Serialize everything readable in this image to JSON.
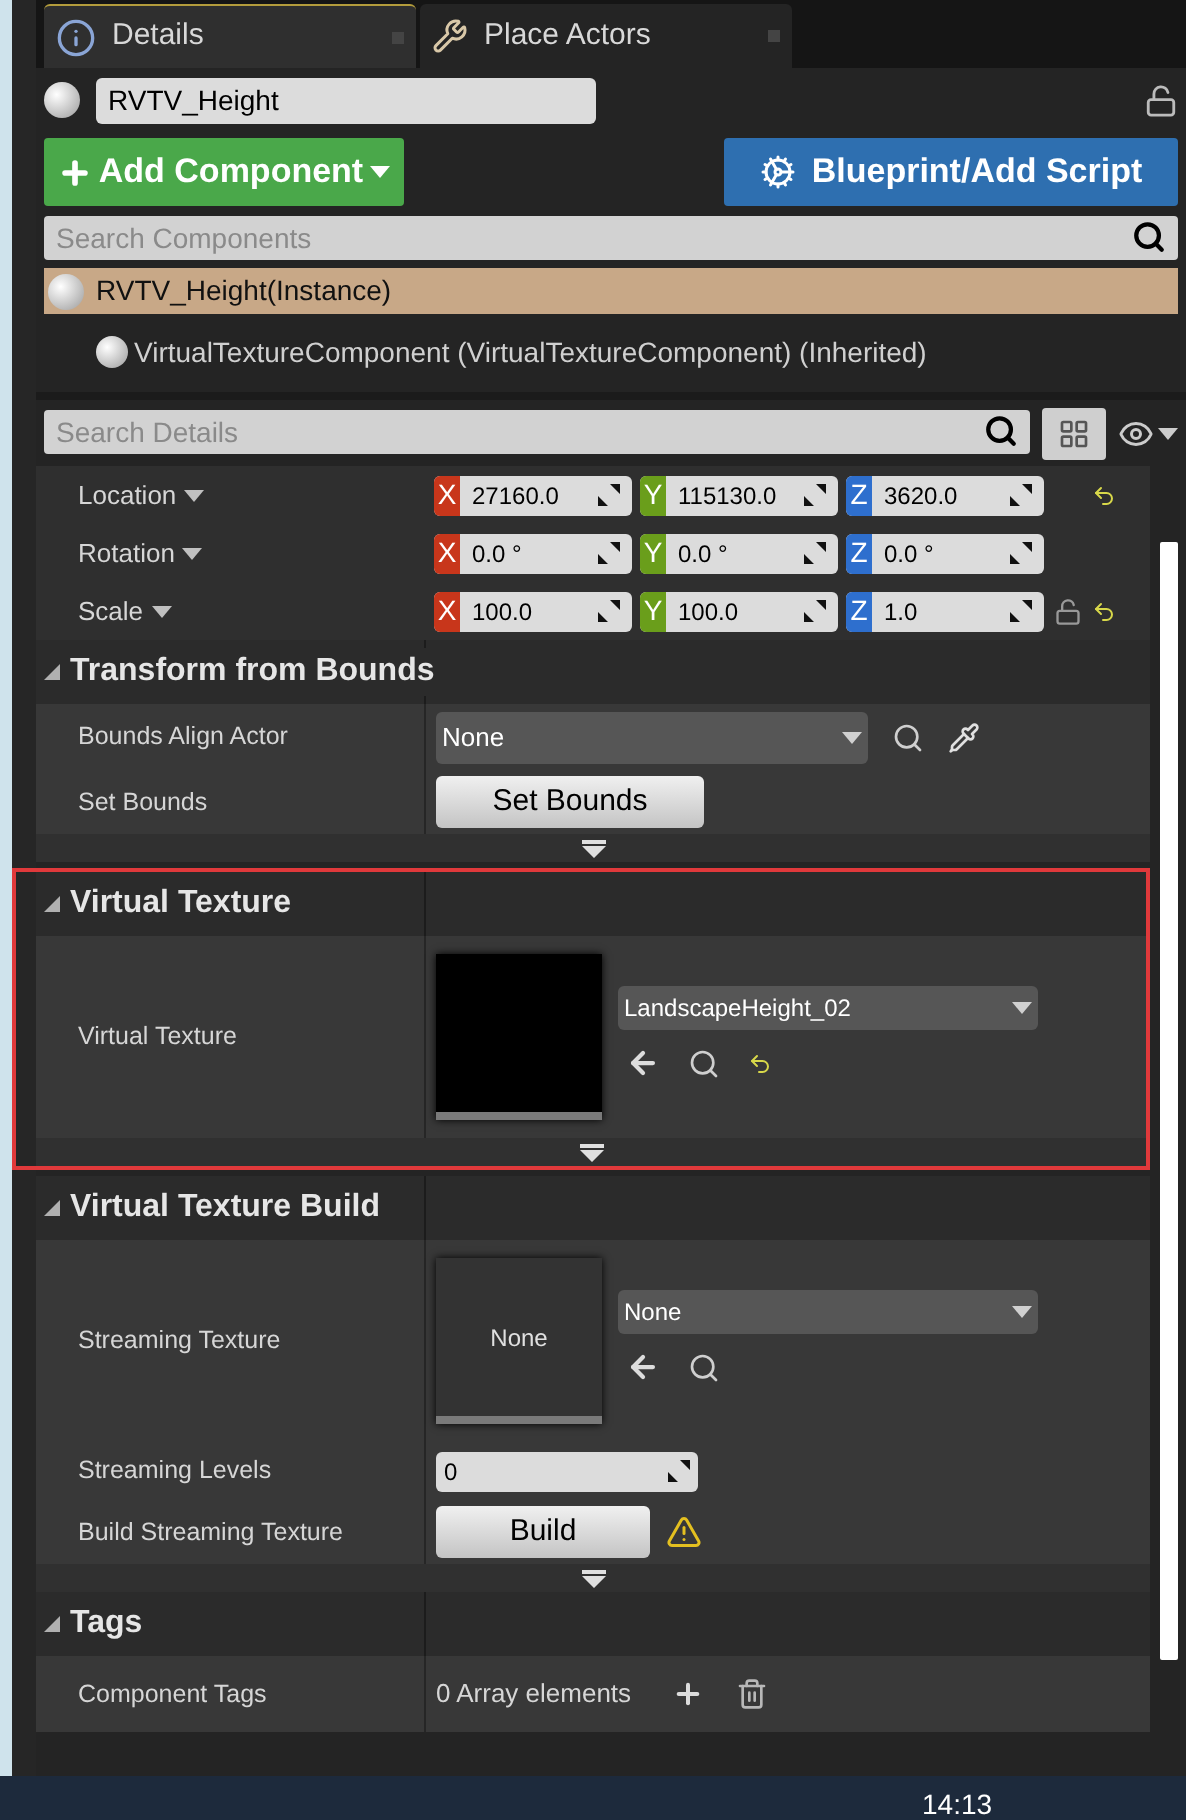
{
  "tabs": [
    {
      "label": "Details",
      "selected": true
    },
    {
      "label": "Place Actors",
      "selected": false
    }
  ],
  "actor": {
    "name": "RVTV_Height",
    "locked": false
  },
  "add_component": {
    "label": "Add Component"
  },
  "blueprint": {
    "label": "Blueprint/Add Script"
  },
  "component_search": {
    "placeholder": "Search Components"
  },
  "components": [
    {
      "label": "RVTV_Height(Instance)",
      "selected": true,
      "children": [
        {
          "label": "VirtualTextureComponent (VirtualTextureComponent) (Inherited)",
          "selected": false
        }
      ]
    }
  ],
  "details_search": {
    "placeholder": "Search Details"
  },
  "transform": [
    {
      "label": "Location",
      "axes": [
        "X",
        "Y",
        "Z"
      ],
      "values": [
        "27160.0",
        "115130.0",
        "3620.0"
      ],
      "lockable": false,
      "reset": true
    },
    {
      "label": "Rotation",
      "axes": [
        "X",
        "Y",
        "Z"
      ],
      "values": [
        "0.0 °",
        "0.0 °",
        "0.0 °"
      ],
      "lockable": false,
      "reset": false
    },
    {
      "label": "Scale",
      "axes": [
        "X",
        "Y",
        "Z"
      ],
      "values": [
        "100.0",
        "100.0",
        "1.0"
      ],
      "lockable": true,
      "reset": true
    }
  ],
  "sections": [
    {
      "title": "Transform from Bounds",
      "highlighted": false,
      "more": true,
      "rows": [
        {
          "kind": "combo",
          "label": "Bounds Align Actor",
          "value": "None"
        },
        {
          "kind": "button",
          "label": "Set Bounds",
          "button": "Set Bounds",
          "warning": false
        }
      ]
    },
    {
      "title": "Virtual Texture",
      "highlighted": true,
      "more": true,
      "rows": [
        {
          "kind": "asset",
          "label": "Virtual Texture",
          "value": "LandscapeHeight_02",
          "assigned": true,
          "reset": true
        }
      ]
    },
    {
      "title": "Virtual Texture Build",
      "highlighted": false,
      "more": true,
      "rows": [
        {
          "kind": "asset",
          "label": "Streaming Texture",
          "value": "None",
          "assigned": false,
          "thumbnail_label": "None",
          "reset": false
        },
        {
          "kind": "number",
          "label": "Streaming Levels",
          "value": "0"
        },
        {
          "kind": "button",
          "label": "Build Streaming Texture",
          "button": "Build",
          "warning": true
        }
      ]
    },
    {
      "title": "Tags",
      "highlighted": false,
      "more": false,
      "rows": [
        {
          "kind": "array",
          "label": "Component Tags",
          "value": "0 Array elements"
        }
      ]
    }
  ],
  "taskbar": {
    "clock": "14:13"
  }
}
